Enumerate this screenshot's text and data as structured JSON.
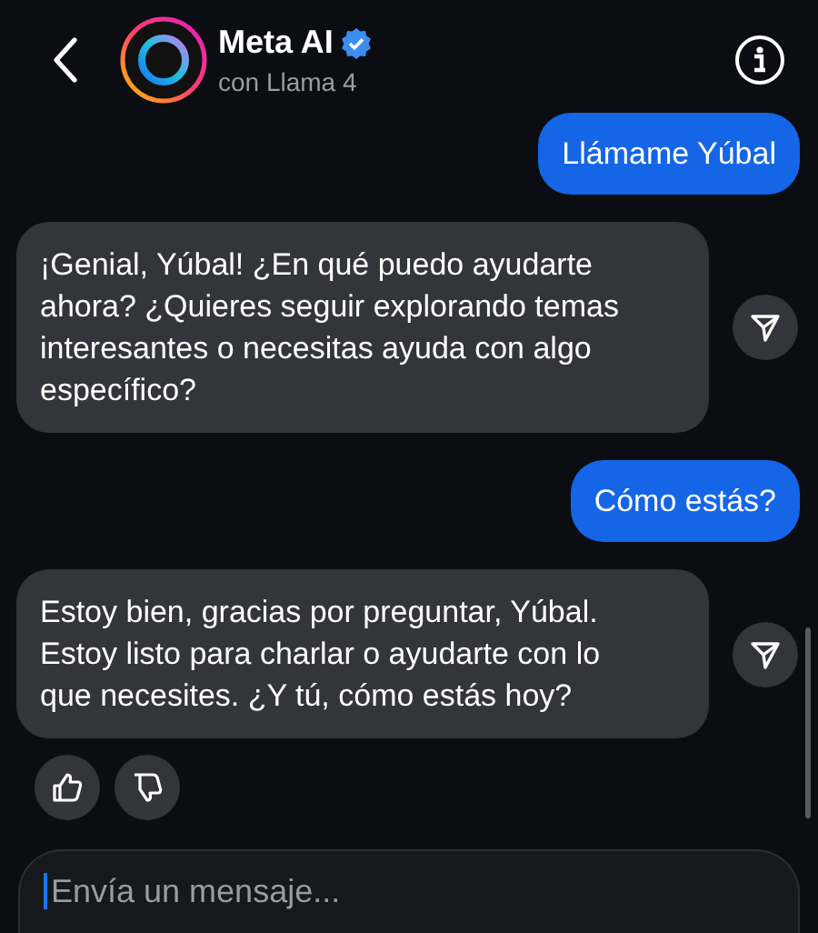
{
  "header": {
    "title": "Meta AI",
    "verified": true,
    "subtitle": "con Llama 4"
  },
  "messages": [
    {
      "kind": "sent",
      "text": "Llámame Yúbal"
    },
    {
      "kind": "received",
      "text": "¡Genial, Yúbal! ¿En qué puedo ayudarte ahora? ¿Quieres seguir explorando temas interesantes o necesitas ayuda con algo específico?"
    },
    {
      "kind": "sent",
      "text": "Cómo estás?"
    },
    {
      "kind": "received",
      "text": "Estoy bien, gracias por preguntar, Yúbal. Estoy listo para charlar o ayudarte con lo que necesites. ¿Y tú, cómo estás hoy?",
      "feedback": true
    }
  ],
  "composer": {
    "placeholder": "Envía un mensaje..."
  }
}
